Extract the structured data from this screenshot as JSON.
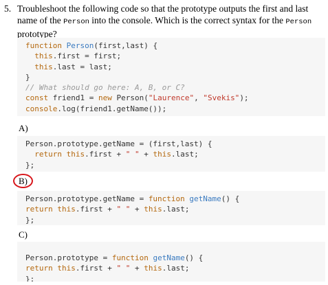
{
  "question": {
    "number": "5.",
    "text_part1": "Troubleshoot the following code so that the prototype outputs the first and last name of the ",
    "inline1": "Person",
    "text_part2": " into the console. Which is the correct syntax for the ",
    "inline2": "Person",
    "text_part3": " prototype?"
  },
  "main_code": [
    [
      [
        "kw",
        "function "
      ],
      [
        "fn",
        "Person"
      ],
      [
        "plain",
        "(first,last) {"
      ]
    ],
    [
      [
        "plain",
        "  "
      ],
      [
        "this",
        "this"
      ],
      [
        "plain",
        ".first = first;"
      ]
    ],
    [
      [
        "plain",
        "  "
      ],
      [
        "this",
        "this"
      ],
      [
        "plain",
        ".last = last;"
      ]
    ],
    [
      [
        "plain",
        "}"
      ]
    ],
    [
      [
        "cmt",
        "// What should go here: A, B, or C?"
      ]
    ],
    [
      [
        "kw",
        "const "
      ],
      [
        "plain",
        "friend1 = "
      ],
      [
        "kw",
        "new "
      ],
      [
        "plain",
        "Person("
      ],
      [
        "str",
        "\"Laurence\""
      ],
      [
        "plain",
        ", "
      ],
      [
        "str",
        "\"Svekis\""
      ],
      [
        "plain",
        ");"
      ]
    ],
    [
      [
        "obj",
        "console"
      ],
      [
        "plain",
        ".log(friend1.getName());"
      ]
    ]
  ],
  "options": [
    {
      "label": "A)",
      "code": [
        [
          [
            "plain",
            "Person.prototype.getName = (first,last) {"
          ]
        ],
        [
          [
            "plain",
            "  "
          ],
          [
            "kw",
            "return "
          ],
          [
            "this",
            "this"
          ],
          [
            "plain",
            ".first + "
          ],
          [
            "str",
            "\" \""
          ],
          [
            "plain",
            " + "
          ],
          [
            "this",
            "this"
          ],
          [
            "plain",
            ".last;"
          ]
        ],
        [
          [
            "plain",
            "};"
          ]
        ]
      ]
    },
    {
      "label": "B)",
      "code": [
        [
          [
            "plain",
            "Person.prototype.getName = "
          ],
          [
            "kw",
            "function "
          ],
          [
            "fn",
            "getName"
          ],
          [
            "plain",
            "() {"
          ]
        ],
        [
          [
            "kw",
            "return "
          ],
          [
            "this",
            "this"
          ],
          [
            "plain",
            ".first + "
          ],
          [
            "str",
            "\" \""
          ],
          [
            "plain",
            " + "
          ],
          [
            "this",
            "this"
          ],
          [
            "plain",
            ".last;"
          ]
        ],
        [
          [
            "plain",
            "};"
          ]
        ]
      ]
    },
    {
      "label": "C)",
      "code": [
        [
          [
            "plain",
            "Person.prototype = "
          ],
          [
            "kw",
            "function "
          ],
          [
            "fn",
            "getName"
          ],
          [
            "plain",
            "() {"
          ]
        ],
        [
          [
            "kw",
            "return "
          ],
          [
            "this",
            "this"
          ],
          [
            "plain",
            ".first + "
          ],
          [
            "str",
            "\" \""
          ],
          [
            "plain",
            " + "
          ],
          [
            "this",
            "this"
          ],
          [
            "plain",
            ".last;"
          ]
        ],
        [
          [
            "plain",
            "};"
          ]
        ]
      ]
    }
  ],
  "colors": {
    "keyword": "#b4680e",
    "function_name": "#3b7bc0",
    "string": "#c0392b",
    "comment": "#999999",
    "code_background": "#f6f6f6",
    "circle_annotation": "#d8161b"
  }
}
